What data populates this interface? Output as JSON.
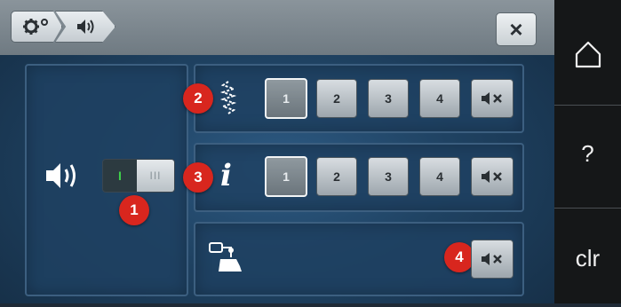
{
  "header": {
    "breadcrumb_settings_icon": "gear-icon",
    "breadcrumb_sound_icon": "speaker-icon",
    "close_icon": "close-icon",
    "close_label": "×"
  },
  "left_panel": {
    "icon": "speaker-icon",
    "toggle_on_label": "I",
    "toggle_off_label": "III",
    "badge": "1"
  },
  "rows": [
    {
      "icon": "stitch-icon",
      "badge": "2",
      "options": [
        "1",
        "2",
        "3",
        "4"
      ],
      "selected": "1",
      "mute_icon": "mute-icon"
    },
    {
      "icon": "info-icon",
      "icon_text": "i",
      "badge": "3",
      "options": [
        "1",
        "2",
        "3",
        "4"
      ],
      "selected": "1",
      "mute_icon": "mute-icon"
    },
    {
      "icon": "presser-foot-icon",
      "badge": "4",
      "mute_icon": "mute-icon"
    }
  ],
  "sidebar": {
    "home_icon": "home-icon",
    "help_label": "?",
    "clear_label": "clr"
  },
  "colors": {
    "badge": "#d8261e",
    "background": "#1f4262",
    "sidebar": "#151718"
  }
}
